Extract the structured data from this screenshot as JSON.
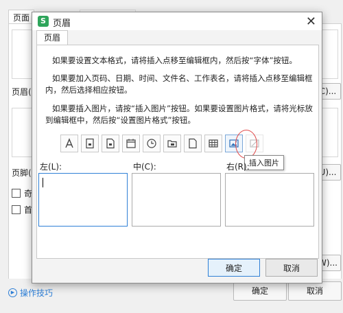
{
  "background": {
    "tab_label": "页面",
    "header_label": "页眉(",
    "header_btn": "C)...",
    "footer_label": "页脚(",
    "footer_btn": "U)...",
    "check1_label": "奇",
    "check2_label": "首",
    "w_btn": "W)...",
    "ok_label": "确定",
    "cancel_label": "取消",
    "tips_label": "操作技巧"
  },
  "dialog": {
    "logo": "S",
    "title": "页眉",
    "tab": "页眉",
    "instructions": [
      "如果要设置文本格式，请将插入点移至编辑框内，然后按“字体”按钮。",
      "如果要加入页码、日期、时间、文件名、工作表名，请将插入点移至编辑框内，然后选择相应按钮。",
      "如果要插入图片，请按“插入图片”按钮。如果要设置图片格式，请将光标放到编辑框中，然后按“设置图片格式”按钮。"
    ],
    "tooltip": "插入图片",
    "sections": {
      "left": "左(L):",
      "center": "中(C):",
      "right": "右(R):"
    },
    "buttons": {
      "ok": "确定",
      "cancel": "取消"
    },
    "toolbar_icons": [
      "font-icon",
      "page-number-icon",
      "total-pages-icon",
      "date-icon",
      "time-icon",
      "file-path-icon",
      "file-name-icon",
      "sheet-name-icon",
      "insert-picture-icon",
      "format-picture-icon"
    ]
  }
}
